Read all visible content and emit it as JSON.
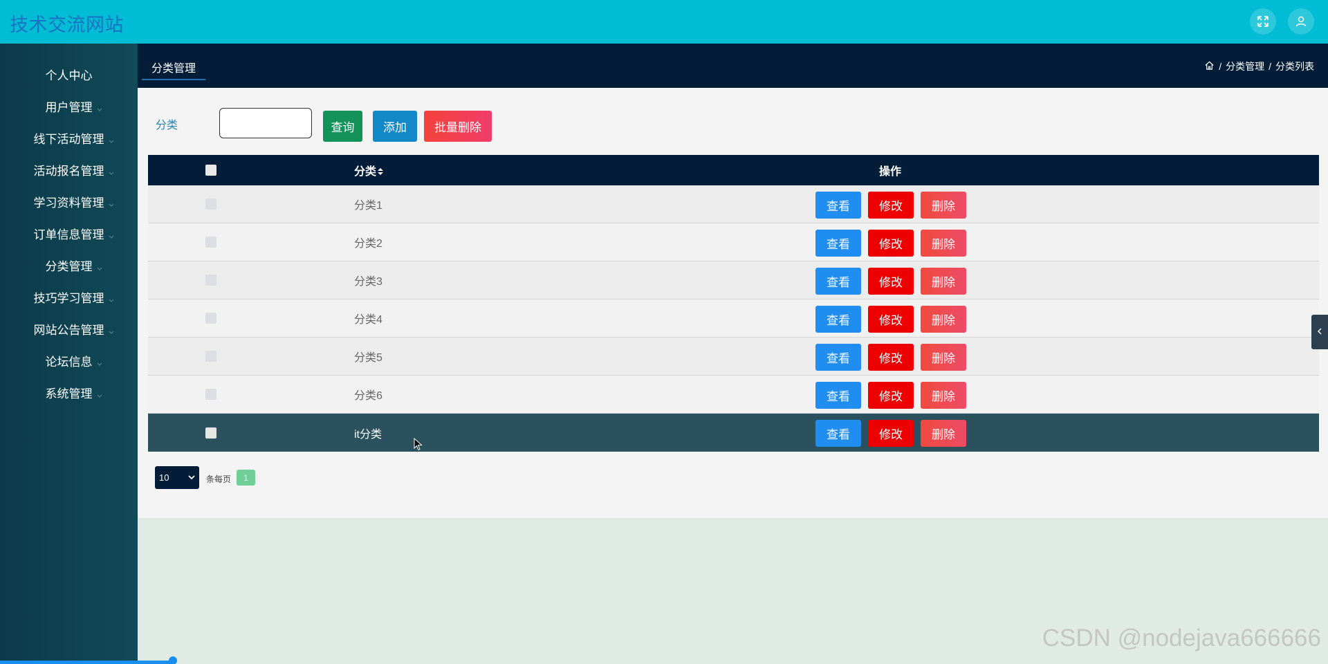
{
  "header": {
    "site_title": "技术交流网站",
    "icons": [
      "fullscreen-icon",
      "user-icon"
    ]
  },
  "sidebar": {
    "items": [
      {
        "label": "个人中心"
      },
      {
        "label": "用户管理"
      },
      {
        "label": "线下活动管理"
      },
      {
        "label": "活动报名管理"
      },
      {
        "label": "学习资料管理"
      },
      {
        "label": "订单信息管理"
      },
      {
        "label": "分类管理"
      },
      {
        "label": "技巧学习管理"
      },
      {
        "label": "网站公告管理"
      },
      {
        "label": "论坛信息"
      },
      {
        "label": "系统管理"
      }
    ]
  },
  "tabs": [
    {
      "label": "分类管理"
    }
  ],
  "breadcrumb": {
    "items": [
      "分类管理",
      "分类列表"
    ],
    "separator": "/"
  },
  "search": {
    "label": "分类",
    "value": "",
    "placeholder": ""
  },
  "toolbar": {
    "query_label": "查询",
    "add_label": "添加",
    "batch_delete_label": "批量删除"
  },
  "table": {
    "columns": [
      "分类",
      "操作"
    ],
    "rows": [
      {
        "category": "分类1"
      },
      {
        "category": "分类2"
      },
      {
        "category": "分类3"
      },
      {
        "category": "分类4"
      },
      {
        "category": "分类5"
      },
      {
        "category": "分类6"
      },
      {
        "category": "it分类"
      }
    ],
    "actions": {
      "view": "查看",
      "edit": "修改",
      "delete": "删除"
    }
  },
  "pagination": {
    "page_size": "10",
    "per_page_label": "条每页",
    "current_page": "1"
  },
  "watermark": "CSDN @nodejava666666",
  "colors": {
    "header": "#00bcd4",
    "sidebar": "#0c3a4a",
    "nav_dark": "#031c38",
    "view": "#1f8ef0",
    "edit": "#ee0000",
    "delete": "#ee4c66"
  }
}
